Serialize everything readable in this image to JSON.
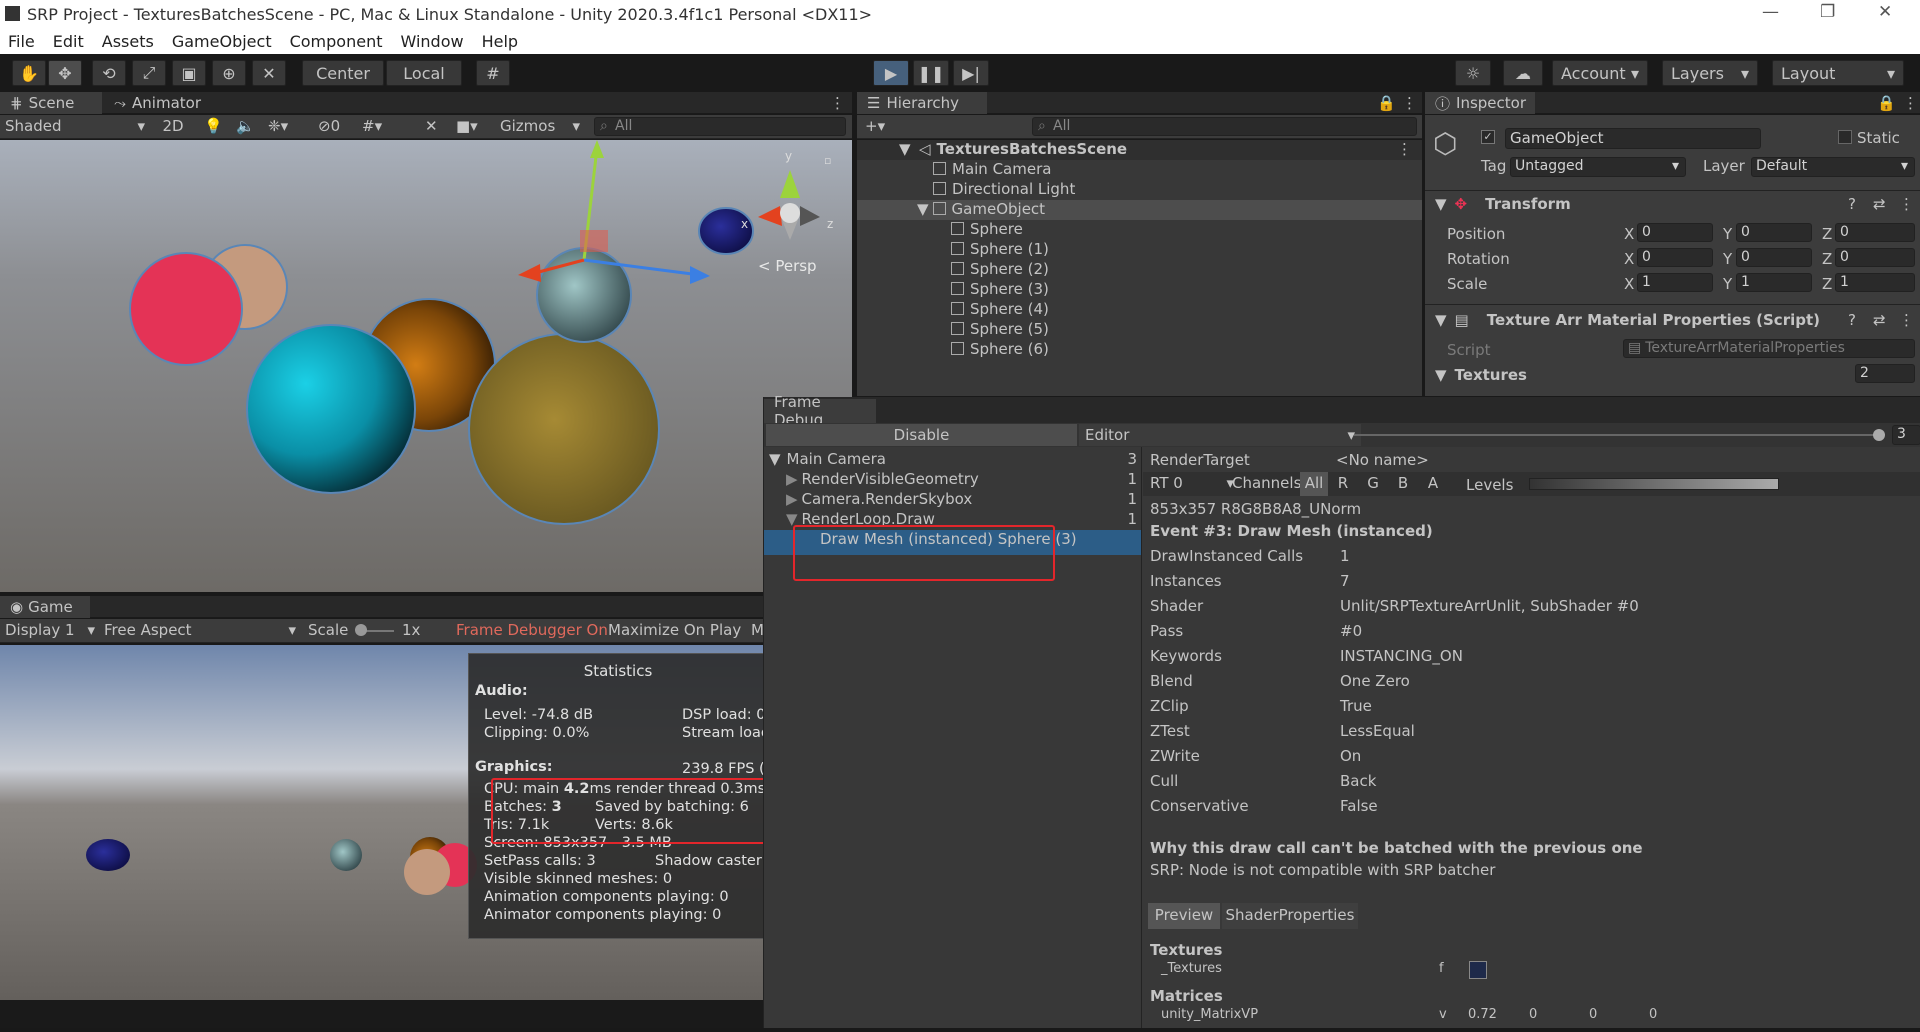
{
  "window": {
    "title": "SRP Project - TexturesBatchesScene - PC, Mac & Linux Standalone - Unity 2020.3.4f1c1 Personal <DX11>"
  },
  "menu": [
    "File",
    "Edit",
    "Assets",
    "GameObject",
    "Component",
    "Window",
    "Help"
  ],
  "toolbar": {
    "center_label": "Center",
    "local_label": "Local",
    "account_label": "Account",
    "layers_label": "Layers",
    "layout_label": "Layout"
  },
  "scene": {
    "tab_scene": "Scene",
    "tab_animator": "Animator",
    "shading": "Shaded",
    "mode_2d": "2D",
    "hidden_count": "0",
    "gizmos_label": "Gizmos",
    "search_placeholder": "All",
    "persp_label": "< Persp",
    "axis_x": "x",
    "axis_y": "y",
    "axis_z": "z"
  },
  "game": {
    "tab_game": "Game",
    "display": "Display 1",
    "aspect": "Free Aspect",
    "scale_label": "Scale",
    "scale_value": "1x",
    "frame_debugger": "Frame Debugger On",
    "maximize": "Maximize On Play",
    "cut_label": "M"
  },
  "stats": {
    "title": "Statistics",
    "audio_heading": "Audio:",
    "level": "Level: -74.8 dB",
    "clipping": "Clipping: 0.0%",
    "dsp": "DSP load: 0",
    "stream": "Stream load",
    "graphics_heading": "Graphics:",
    "fps": "239.8 FPS (",
    "cpu_prefix": "CPU: main ",
    "cpu_main": "4.2",
    "cpu_suffix": "ms  render thread 0.3ms",
    "batches_prefix": "Batches: ",
    "batches": "3",
    "saved": "Saved by batching: 6",
    "tris": "Tris: 7.1k",
    "verts": "Verts: 8.6k",
    "screen": "Screen: 853x357 - 3.5 MB",
    "setpass": "SetPass calls: 3",
    "shadow": "Shadow caster",
    "skinned": "Visible skinned meshes: 0",
    "anim_components": "Animation components playing: 0",
    "animator_components": "Animator components playing: 0"
  },
  "hierarchy": {
    "tab": "Hierarchy",
    "search_placeholder": "All",
    "scene_name": "TexturesBatchesScene",
    "items": [
      "Main Camera",
      "Directional Light",
      "GameObject",
      "Sphere",
      "Sphere (1)",
      "Sphere (2)",
      "Sphere (3)",
      "Sphere (4)",
      "Sphere (5)",
      "Sphere (6)"
    ]
  },
  "inspector": {
    "tab": "Inspector",
    "object_name": "GameObject",
    "static_label": "Static",
    "tag_label": "Tag",
    "tag_value": "Untagged",
    "layer_label": "Layer",
    "layer_value": "Default",
    "transform_title": "Transform",
    "position_label": "Position",
    "rotation_label": "Rotation",
    "scale_label": "Scale",
    "x": "X",
    "y": "Y",
    "z": "Z",
    "position": [
      "0",
      "0",
      "0"
    ],
    "rotation": [
      "0",
      "0",
      "0"
    ],
    "scale": [
      "1",
      "1",
      "1"
    ],
    "script_component": "Texture Arr Material Properties (Script)",
    "script_label": "Script",
    "script_value": "TextureArrMaterialProperties",
    "textures_label": "Textures",
    "textures_count": "2"
  },
  "frame_debug": {
    "tab": "Frame Debug",
    "disable_label": "Disable",
    "editor_label": "Editor",
    "event_index": "3",
    "tree": [
      {
        "label": "Main Camera",
        "count": "3"
      },
      {
        "label": "RenderVisibleGeometry",
        "count": "1"
      },
      {
        "label": "Camera.RenderSkybox",
        "count": "1"
      },
      {
        "label": "RenderLoop.Draw",
        "count": "1"
      },
      {
        "label": "Draw Mesh (instanced) Sphere (3)",
        "count": ""
      }
    ],
    "render_target_label": "RenderTarget",
    "render_target_value": "<No name>",
    "rt_label": "RT 0",
    "channels_label": "Channels",
    "channels": [
      "All",
      "R",
      "G",
      "B",
      "A"
    ],
    "levels_label": "Levels",
    "format": "853x357 R8G8B8A8_UNorm",
    "event_title": "Event #3: Draw Mesh (instanced)",
    "props": [
      {
        "k": "DrawInstanced Calls",
        "v": "1"
      },
      {
        "k": "Instances",
        "v": "7"
      },
      {
        "k": "Shader",
        "v": "Unlit/SRPTextureArrUnlit, SubShader #0"
      },
      {
        "k": "Pass",
        "v": "#0"
      },
      {
        "k": "Keywords",
        "v": "INSTANCING_ON"
      },
      {
        "k": "Blend",
        "v": "One Zero"
      },
      {
        "k": "ZClip",
        "v": "True"
      },
      {
        "k": "ZTest",
        "v": "LessEqual"
      },
      {
        "k": "ZWrite",
        "v": "On"
      },
      {
        "k": "Cull",
        "v": "Back"
      },
      {
        "k": "Conservative",
        "v": "False"
      }
    ],
    "why_title": "Why this draw call can't be batched with the previous one",
    "why_reason": "SRP: Node is not compatible with SRP batcher",
    "preview_tab": "Preview",
    "shaderprops_tab": "ShaderProperties",
    "textures_heading": "Textures",
    "tex_name": "_Textures",
    "tex_type": "f",
    "matrices_heading": "Matrices",
    "matrix_name": "unity_MatrixVP",
    "matrix_type": "v",
    "matrix_values": [
      "0.72",
      "0",
      "0",
      "0"
    ]
  }
}
